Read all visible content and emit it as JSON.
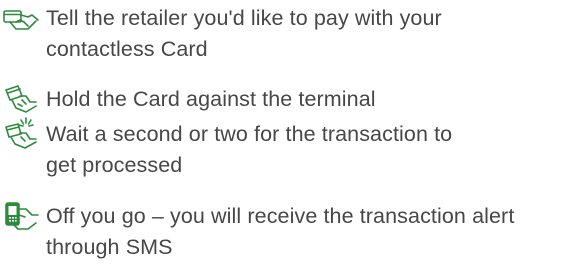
{
  "steps": [
    {
      "icon": "hand-card-tell-icon",
      "lines": [
        "Tell the retailer you'd like to pay with your",
        "contactless Card"
      ]
    },
    {
      "icon": "hand-hold-card-icon",
      "lines": [
        "Hold the Card against the terminal"
      ]
    },
    {
      "icon": "hand-tap-card-icon",
      "lines": [
        "Wait a second or two for the transaction to",
        "get processed"
      ]
    },
    {
      "icon": "hand-phone-sms-icon",
      "lines": [
        "Off you go – you will receive the transaction alert",
        "through SMS"
      ]
    }
  ],
  "colors": {
    "icon_green": "#2e8b3e",
    "text": "#474747",
    "background": "#ffffff"
  }
}
